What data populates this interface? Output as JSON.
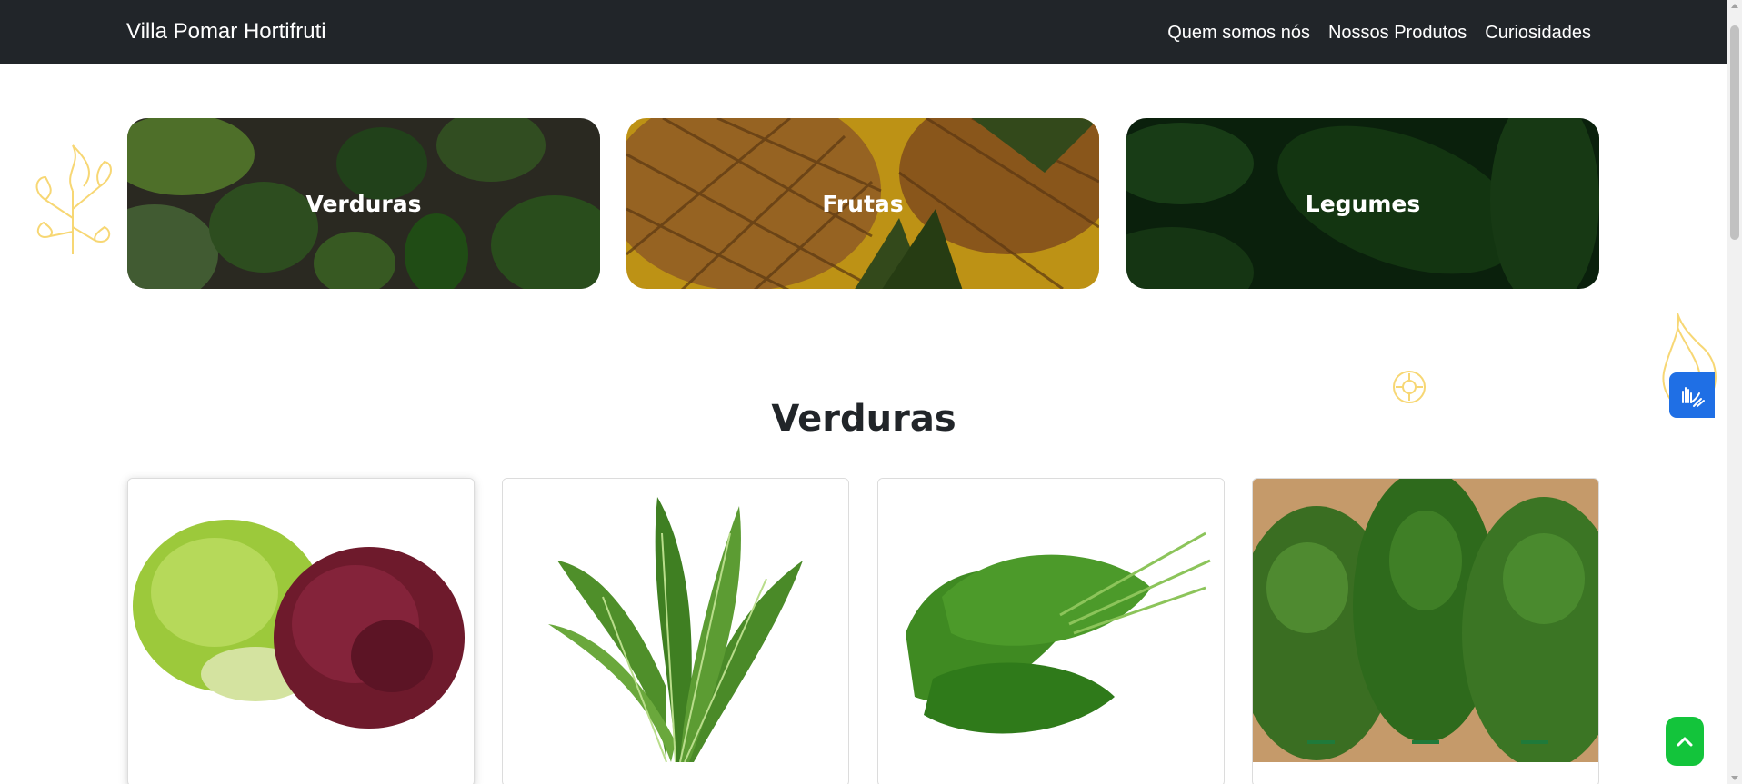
{
  "navbar": {
    "brand": "Villa Pomar Hortifruti",
    "links": [
      "Quem somos nós",
      "Nossos Produtos",
      "Curiosidades"
    ]
  },
  "categories": [
    {
      "label": "Verduras"
    },
    {
      "label": "Frutas"
    },
    {
      "label": "Legumes"
    }
  ],
  "section": {
    "title": "Verduras"
  },
  "products": [
    {
      "image": "alface-crespa-roxa-e-verde"
    },
    {
      "image": "rucula"
    },
    {
      "image": "espinafre"
    },
    {
      "image": "cheiro-verde-mix"
    }
  ],
  "widgets": {
    "libras_icon": "hands-sign-language-icon",
    "back_to_top_icon": "chevron-up-icon"
  },
  "colors": {
    "navbar": "#212529",
    "accent_blue": "#1f6fe5",
    "accent_green": "#13c43b",
    "decoration_yellow": "#f7d774"
  }
}
